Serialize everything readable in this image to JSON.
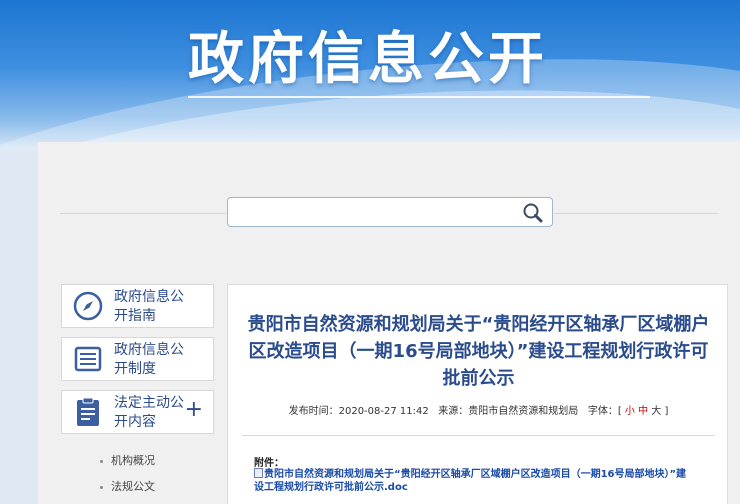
{
  "banner": {
    "title": "政府信息公开"
  },
  "search": {
    "placeholder": ""
  },
  "nav": [
    {
      "label": "政府信息公开指南",
      "icon": "compass-icon"
    },
    {
      "label": "政府信息公开制度",
      "icon": "list-document-icon"
    },
    {
      "label": "法定主动公开内容",
      "icon": "clipboard-icon",
      "expand": "+"
    }
  ],
  "subnav": [
    "机构概况",
    "法规公文"
  ],
  "article": {
    "title": "贵阳市自然资源和规划局关于“贵阳经开区轴承厂区域棚户区改造项目（一期16号局部地块）”建设工程规划行政许可批前公示",
    "publish_label": "发布时间：",
    "publish_time": "2020-08-27 11:42",
    "source_label": "来源：",
    "source": "贵阳市自然资源和规划局",
    "font_label": "字体：[",
    "font_small": "小",
    "font_medium": "中",
    "font_large": "大",
    "font_close": "]",
    "attachment_label": "附件：",
    "attachment_name": "贵阳市自然资源和规划局关于“贵阳经开区轴承厂区域棚户区改造项目（一期16号局部地块）”建设工程规划行政许可批前公示.doc"
  }
}
